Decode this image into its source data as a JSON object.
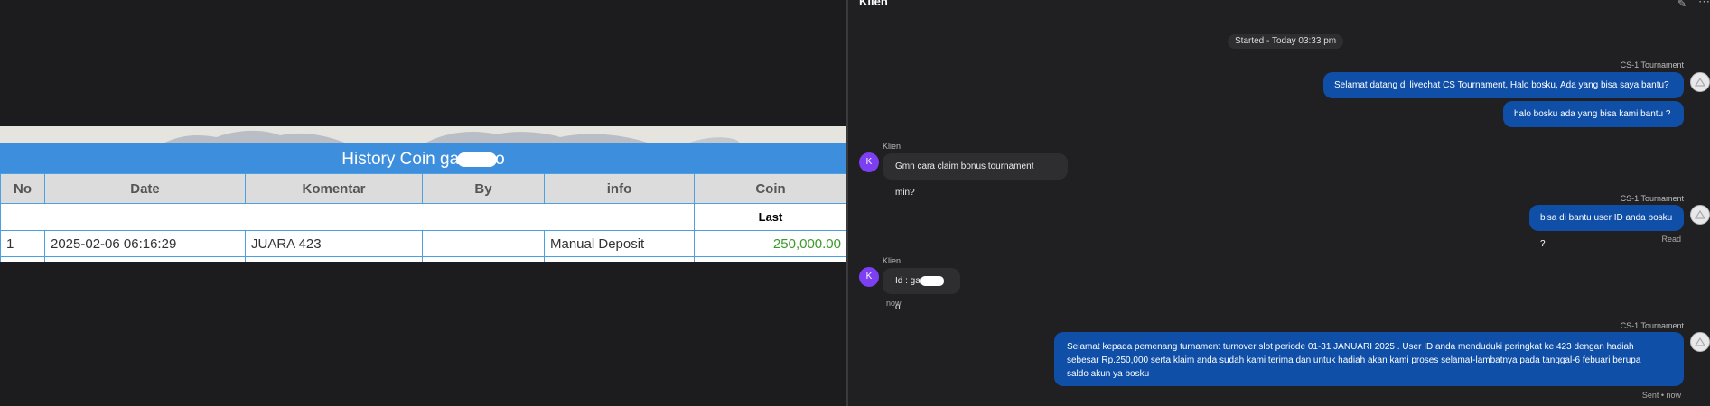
{
  "history": {
    "title_prefix": "History Coin ga",
    "title_suffix": "o",
    "columns": [
      "No",
      "Date",
      "Komentar",
      "By",
      "info",
      "Coin"
    ],
    "sub_label": "Last",
    "rows": [
      {
        "no": "1",
        "date": "2025-02-06 06:16:29",
        "komentar": "JUARA 423",
        "by": "",
        "info": "Manual Deposit",
        "coin": "250,000.00"
      }
    ]
  },
  "chat": {
    "title": "Klien",
    "started": "Started - Today 03:33 pm",
    "agent_name": "CS-1 Tournament",
    "client_name": "Klien",
    "client_initial": "K",
    "messages": {
      "m1": "Selamat datang di livechat CS Tournament, Halo bosku, Ada yang bisa saya bantu?",
      "m2": "halo bosku ada yang bisa kami bantu ?",
      "m3": "Gmn cara claim bonus tournament min?",
      "m4": "bisa di bantu user ID anda bosku ?",
      "m4_status": "Read",
      "m5_prefix": "Id : ga",
      "m5_suffix": "o",
      "m5_time": "now",
      "m6_line1": "Selamat kepada pemenang turnament turnover slot periode 01-31 JANUARI 2025 . User ID anda menduduki peringkat ke 423 dengan hadiah",
      "m6_line2": "sebesar Rp.250,000 serta klaim anda sudah kami terima dan untuk hadiah akan kami proses selamat-lambatnya pada tanggal-6 febuari berupa",
      "m6_line3": "saldo akun ya bosku",
      "m6_status": "Sent • now"
    }
  },
  "icons": {
    "edit": "pencil-icon",
    "more": "more-icon",
    "bot_avatar": "bot-avatar-icon"
  }
}
